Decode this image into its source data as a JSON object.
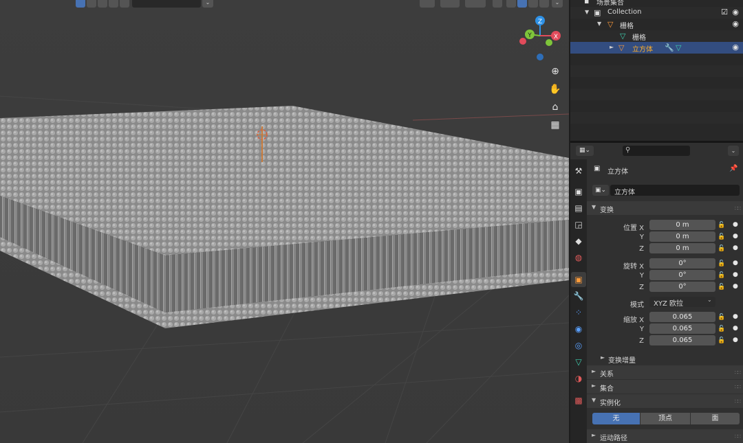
{
  "header": {
    "search_placeholder": ""
  },
  "outliner": {
    "root_label": "场景集合",
    "rows": [
      {
        "label": "Collection"
      },
      {
        "label": "栅格"
      },
      {
        "label": "栅格"
      },
      {
        "label": "立方体"
      }
    ]
  },
  "nav": {
    "zoom_icon": "zoom-icon",
    "pan_icon": "hand-icon",
    "camera_icon": "camera-icon",
    "ortho_icon": "grid-icon"
  },
  "gizmo": {
    "x_label": "X",
    "y_label": "Y",
    "z_label": "Z"
  },
  "properties": {
    "object_title": "立方体",
    "object_name_field": "立方体",
    "transform_panel": "变换",
    "location_label": "位置 X",
    "y_label": "Y",
    "z_label": "Z",
    "loc_x": "0 m",
    "loc_y": "0 m",
    "loc_z": "0 m",
    "rotation_label": "旋转 X",
    "rot_x": "0°",
    "rot_y": "0°",
    "rot_z": "0°",
    "mode_label": "模式",
    "mode_value": "XYZ 欧拉",
    "scale_label": "缩放 X",
    "scale_x": "0.065",
    "scale_y": "0.065",
    "scale_z": "0.065",
    "delta_transform": "变换增量",
    "relations": "关系",
    "collections": "集合",
    "instancing": "实例化",
    "instancing_options": [
      "无",
      "顶点",
      "面"
    ],
    "motion_paths": "运动路径"
  },
  "colors": {
    "accent": "#4772b3",
    "selected_row": "#334d80",
    "object_orange": "#ffaf29",
    "axis_x": "#e24b5b",
    "axis_y": "#7ec53a",
    "axis_z": "#2e91e6"
  }
}
